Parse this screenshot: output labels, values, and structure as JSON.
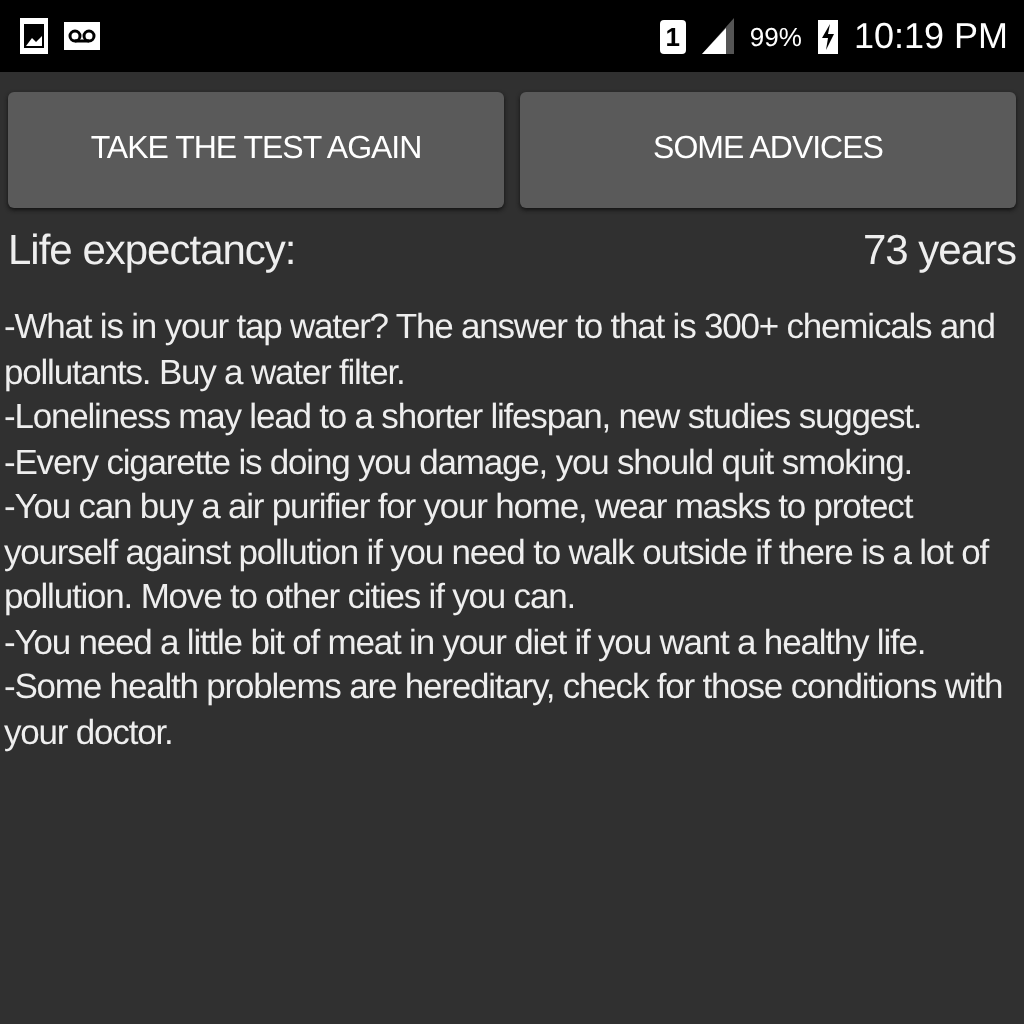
{
  "status_bar": {
    "sim": "1",
    "battery": "99%",
    "time": "10:19 PM"
  },
  "buttons": [
    "TAKE THE TEST AGAIN",
    "SOME ADVICES"
  ],
  "result": {
    "label": "Life expectancy:",
    "value": "73 years"
  },
  "advices": [
    "-What is in your tap water? The answer to that is 300+ chemicals and pollutants. Buy a water filter.",
    "-Loneliness may lead to a shorter lifespan, new studies suggest.",
    "-Every cigarette is doing you damage, you should quit smoking.",
    "-You can buy a air purifier for your home, wear masks to protect yourself against pollution if you need to walk outside if there is a lot of pollution. Move to other cities if you can.",
    "-You need a little bit of meat in your diet if you want a healthy life.",
    "-Some health problems are hereditary, check for those conditions with your doctor."
  ]
}
